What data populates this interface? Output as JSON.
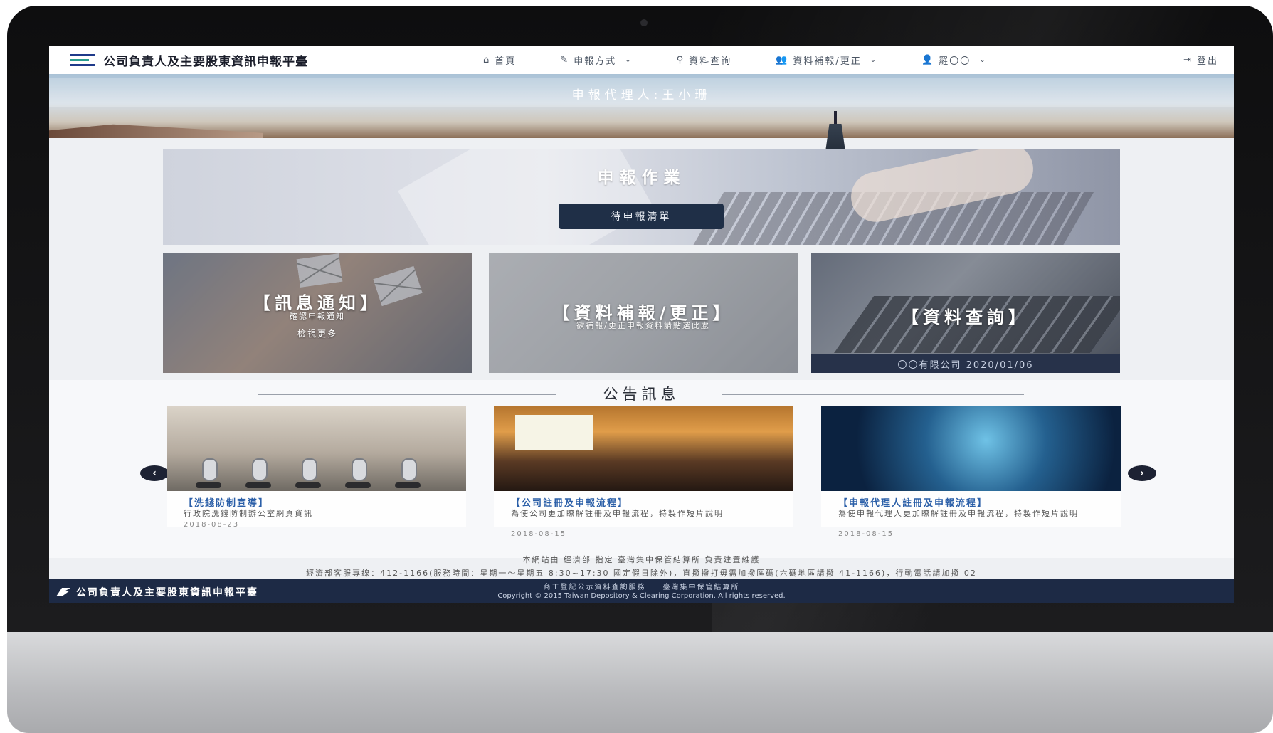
{
  "navbar": {
    "brand": "公司負責人及主要股東資訊申報平臺",
    "items": [
      {
        "label": "首頁",
        "icon": "home-icon",
        "glyph": "⌂",
        "has_dropdown": false
      },
      {
        "label": "申報方式",
        "icon": "pencil-icon",
        "glyph": "✎",
        "has_dropdown": true
      },
      {
        "label": "資料查詢",
        "icon": "search-icon",
        "glyph": "⚲",
        "has_dropdown": false
      },
      {
        "label": "資料補報/更正",
        "icon": "users-icon",
        "glyph": "👥",
        "has_dropdown": true
      },
      {
        "label": "羅〇〇",
        "icon": "user-icon",
        "glyph": "👤",
        "has_dropdown": true
      }
    ],
    "logout": {
      "label": "登出",
      "icon": "logout-icon",
      "glyph": "⇥"
    },
    "chevron": "⌄"
  },
  "banner": {
    "agent_text": "申報代理人:王小珊"
  },
  "hero": {
    "title": "申報作業",
    "button_label": "待申報清單"
  },
  "tiles": [
    {
      "title": "【訊息通知】",
      "subtitle": "確認申報通知",
      "more": "檢視更多"
    },
    {
      "title": "【資料補報/更正】",
      "subtitle": "欲補報/更正申報資料請點選此處"
    },
    {
      "title": "【資料查詢】",
      "footer": "〇〇有限公司 2020/01/06"
    }
  ],
  "announcements": {
    "title": "公告訊息",
    "prev": "‹",
    "next": "›",
    "cards": [
      {
        "title": "【洗錢防制宣導】",
        "desc": "行政院洗錢防制辦公室網頁資訊",
        "date": "2018-08-23"
      },
      {
        "title": "【公司註冊及申報流程】",
        "desc": "為使公司更加瞭解註冊及申報流程，特製作短片說明",
        "date": "2018-08-15"
      },
      {
        "title": "【申報代理人註冊及申報流程】",
        "desc": "為使申報代理人更加瞭解註冊及申報流程，特製作短片說明",
        "date": "2018-08-15"
      }
    ]
  },
  "footer": {
    "line1": "本網站由 經濟部 指定 臺灣集中保管結算所 負責建置維護",
    "line2": "經濟部客服專線：412-1166(服務時間：星期一～星期五 8:30~17:30 國定假日除外)，直撥撥打毋需加撥區碼(六碼地區請撥 41-1166)，行動電話請加撥 02",
    "brand": "公司負責人及主要股東資訊申報平臺",
    "links": "商工登記公示資料查詢服務　　臺灣集中保管結算所",
    "copyright": "Copyright © 2015 Taiwan Depository & Clearing Corporation. All rights reserved."
  },
  "colors": {
    "navy": "#1d2a45",
    "link_blue": "#2b5fa8",
    "button_dark": "#1f2f47"
  }
}
